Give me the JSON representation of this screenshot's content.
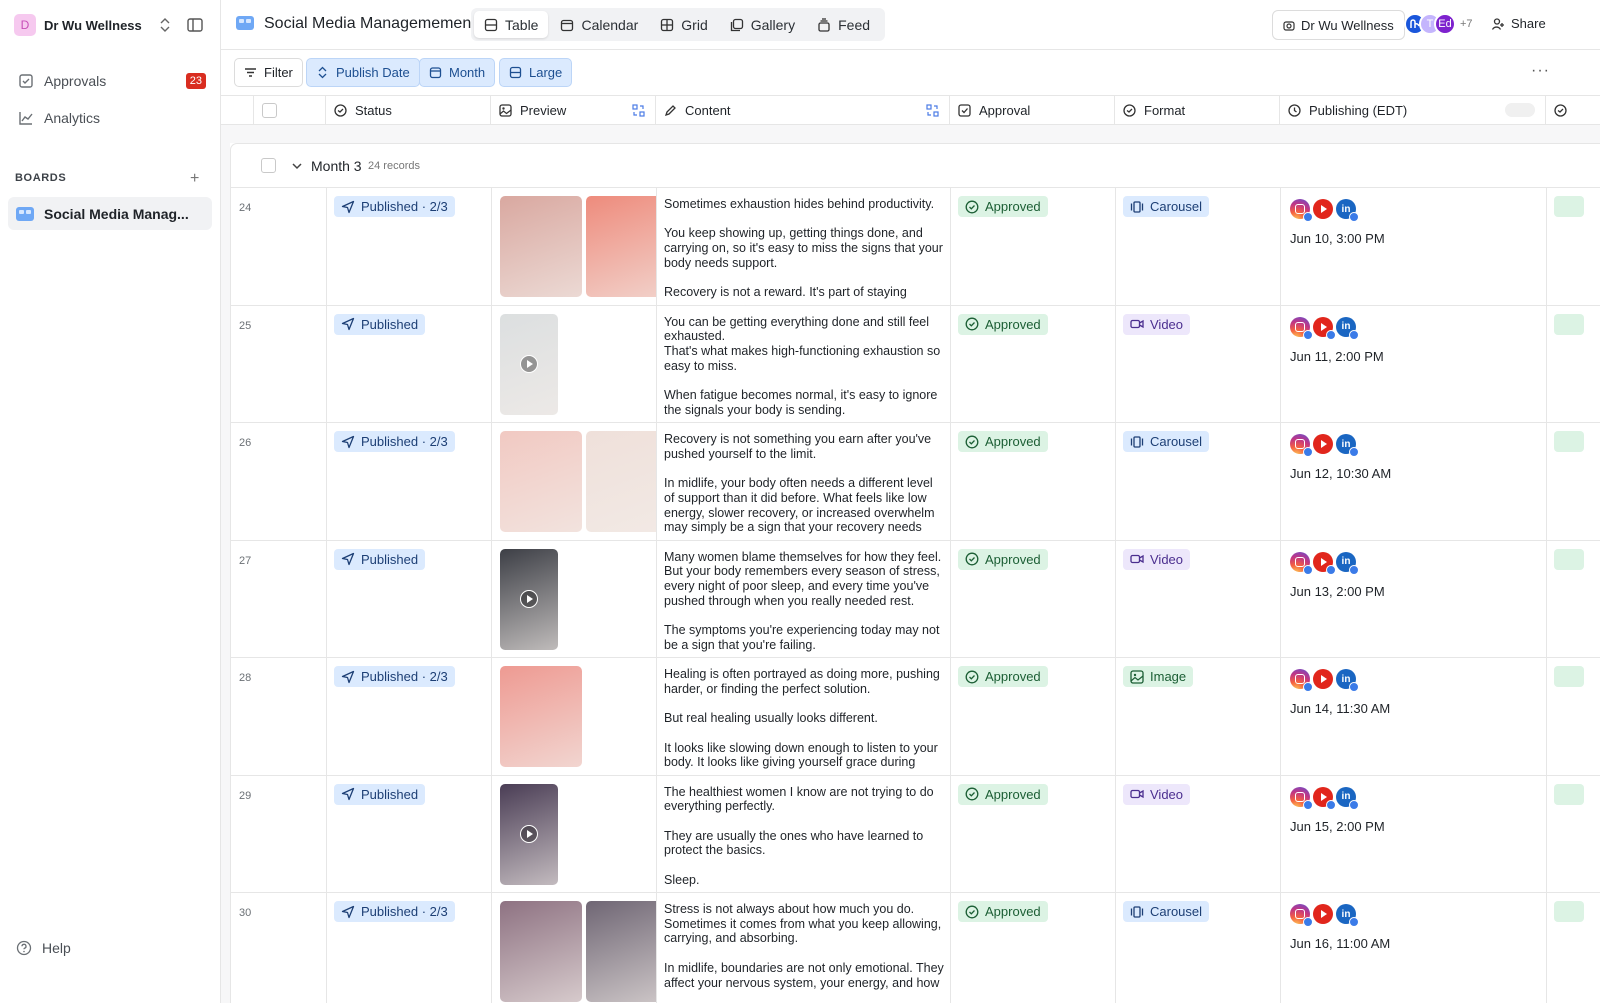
{
  "workspace": {
    "initial": "D",
    "name": "Dr Wu Wellness"
  },
  "sidebar": {
    "items": [
      {
        "label": "Approvals",
        "badge": "23",
        "icon": "approval-check-icon"
      },
      {
        "label": "Analytics",
        "icon": "chart-line-icon"
      }
    ],
    "boards_header": "BOARDS",
    "boards": [
      {
        "label": "Social Media Manag..."
      }
    ],
    "help": "Help"
  },
  "header": {
    "title": "Social Media Managemement",
    "views": [
      {
        "label": "Table",
        "icon": "table-icon",
        "active": true
      },
      {
        "label": "Calendar",
        "icon": "calendar-icon"
      },
      {
        "label": "Grid",
        "icon": "grid-icon"
      },
      {
        "label": "Gallery",
        "icon": "gallery-icon"
      },
      {
        "label": "Feed",
        "icon": "feed-icon"
      }
    ],
    "account_button": "Dr Wu Wellness",
    "avatars": [
      {
        "initial": "",
        "color": "#1a56db"
      },
      {
        "initial": "T",
        "color": "#c4b5fd"
      },
      {
        "initial": "Ed",
        "color": "#7e22ce"
      }
    ],
    "avatars_more": "+7",
    "share": "Share"
  },
  "toolbar": {
    "filter": "Filter",
    "chips": [
      "Publish Date",
      "Month",
      "Large"
    ],
    "more": "···"
  },
  "columns": [
    "Status",
    "Preview",
    "Content",
    "Approval",
    "Format",
    "Publishing (EDT)"
  ],
  "group": {
    "name": "Month 3",
    "count": "24 records"
  },
  "rows": [
    {
      "num": "24",
      "status": "Published · 2/3",
      "approval": "Approved",
      "format": "Carousel",
      "format_type": "carousel",
      "content": "Sometimes exhaustion hides behind productivity.\n\nYou keep showing up, getting things done, and carrying on, so it's easy to miss the signs that your body needs support.\n\nRecovery is not a reward. It's part of staying healthy, resilient, and well.",
      "time": "Jun 10, 3:00 PM",
      "thumbs": [
        "#d9a8a0",
        "#ee8b7c"
      ]
    },
    {
      "num": "25",
      "status": "Published",
      "approval": "Approved",
      "format": "Video",
      "format_type": "video",
      "content": "You can be getting everything done and still feel exhausted.\nThat's what makes high-functioning exhaustion so easy to miss.\n\nWhen fatigue becomes normal, it's easy to ignore the signals your body is sending.\nYou don't have to wait until you're completely",
      "time": "Jun 11, 2:00 PM",
      "thumbs": [
        "#dcdfe0"
      ]
    },
    {
      "num": "26",
      "status": "Published · 2/3",
      "approval": "Approved",
      "format": "Carousel",
      "format_type": "carousel",
      "content": "Recovery is not something you earn after you've pushed yourself to the limit.\n\nIn midlife, your body often needs a different level of support than it did before. What feels like low energy, slower recovery, or increased overwhelm may simply be a sign that your recovery needs have changed.",
      "time": "Jun 12, 10:30 AM",
      "thumbs": [
        "#f1c9c2",
        "#efe0da"
      ]
    },
    {
      "num": "27",
      "status": "Published",
      "approval": "Approved",
      "format": "Video",
      "format_type": "video",
      "content": "Many women blame themselves for how they feel. But your body remembers every season of stress, every night of poor sleep, and every time you've pushed through when you really needed rest.\n\nThe symptoms you're experiencing today may not be a sign that you're failing.",
      "time": "Jun 13, 2:00 PM",
      "thumbs": [
        "#3d3f46"
      ]
    },
    {
      "num": "28",
      "status": "Published · 2/3",
      "approval": "Approved",
      "format": "Image",
      "format_type": "image",
      "content": "Healing is often portrayed as doing more, pushing harder, or finding the perfect solution.\n\nBut real healing usually looks different.\n\nIt looks like slowing down enough to listen to your body. It looks like giving yourself grace during difficult seasons. It looks like choosing support.",
      "time": "Jun 14, 11:30 AM",
      "thumbs": [
        "#ee9a92"
      ]
    },
    {
      "num": "29",
      "status": "Published",
      "approval": "Approved",
      "format": "Video",
      "format_type": "video",
      "content": "The healthiest women I know are not trying to do everything perfectly.\n\nThey are usually the ones who have learned to protect the basics.\n\nSleep.\nEnergy.",
      "time": "Jun 15, 2:00 PM",
      "thumbs": [
        "#4a3d55"
      ]
    },
    {
      "num": "30",
      "status": "Published · 2/3",
      "approval": "Approved",
      "format": "Carousel",
      "format_type": "carousel",
      "content": "Stress is not always about how much you do. Sometimes it comes from what you keep allowing, carrying, and absorbing.\n\nIn midlife, boundaries are not only emotional. They affect your nervous system, your energy, and how",
      "time": "Jun 16, 11:00 AM",
      "thumbs": [
        "#8e7282",
        "#6f6674"
      ]
    }
  ]
}
